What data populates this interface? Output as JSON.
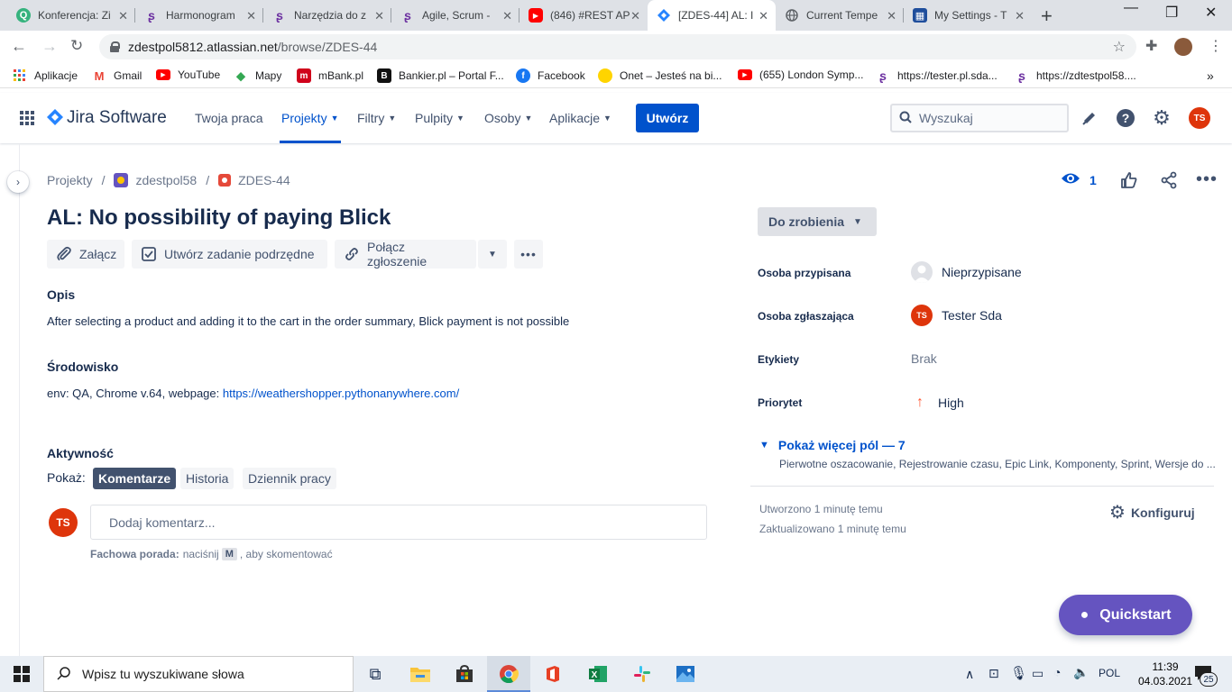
{
  "browser": {
    "tabs": [
      {
        "title": "Konferencja: Zi",
        "icon": "green-q-icon",
        "color": "#36b37e"
      },
      {
        "title": "Harmonogram",
        "icon": "purple-s-icon",
        "color": "#6b2fa0"
      },
      {
        "title": "Narzędzia do z",
        "icon": "purple-s-icon",
        "color": "#6b2fa0"
      },
      {
        "title": "Agile, Scrum -",
        "icon": "purple-s-icon",
        "color": "#6b2fa0"
      },
      {
        "title": "(846) #REST AP",
        "icon": "youtube-icon",
        "color": "#ff0000"
      },
      {
        "title": "[ZDES-44] AL: I",
        "icon": "jira-icon",
        "color": "#2684ff"
      },
      {
        "title": "Current Tempe",
        "icon": "globe-icon",
        "color": "#5f6368"
      },
      {
        "title": "My Settings - T",
        "icon": "settings-page-icon",
        "color": "#1f4e9c"
      }
    ],
    "url_host": "zdestpol5812.atlassian.net",
    "url_path": "/browse/ZDES-44",
    "bookmarks": [
      {
        "label": "Aplikacje",
        "icon": "apps-grid-icon"
      },
      {
        "label": "Gmail",
        "icon": "gmail-icon"
      },
      {
        "label": "YouTube",
        "icon": "youtube-icon"
      },
      {
        "label": "Mapy",
        "icon": "maps-icon"
      },
      {
        "label": "mBank.pl",
        "icon": "mbank-icon"
      },
      {
        "label": "Bankier.pl – Portal F...",
        "icon": "bankier-icon"
      },
      {
        "label": "Facebook",
        "icon": "facebook-icon"
      },
      {
        "label": "Onet – Jesteś na bi...",
        "icon": "onet-icon"
      },
      {
        "label": "(655) London Symp...",
        "icon": "youtube-icon"
      },
      {
        "label": "https://tester.pl.sda...",
        "icon": "purple-s-icon"
      },
      {
        "label": "https://zdtestpol58....",
        "icon": "purple-s-icon"
      }
    ]
  },
  "jira": {
    "logo_text": "Jira Software",
    "nav": [
      "Twoja praca",
      "Projekty",
      "Filtry",
      "Pulpity",
      "Osoby",
      "Aplikacje"
    ],
    "create_label": "Utwórz",
    "search_placeholder": "Wyszukaj",
    "user_initials": "TS"
  },
  "issue": {
    "breadcrumb": [
      "Projekty",
      "zdestpol58",
      "ZDES-44"
    ],
    "watchers": "1",
    "title": "AL: No possibility of paying Blick",
    "toolbar": {
      "attach": "Załącz",
      "subtask": "Utwórz zadanie podrzędne",
      "link": "Połącz zgłoszenie"
    },
    "description_heading": "Opis",
    "description": "After selecting a product and adding it to the cart in the order summary, Blick payment is not possible",
    "environment_heading": "Środowisko",
    "environment_prefix": "env: QA, Chrome v.64, webpage: ",
    "environment_link": "https://weathershopper.pythonanywhere.com/",
    "activity_heading": "Aktywność",
    "activity_show": "Pokaż:",
    "activity_tabs": [
      "Komentarze",
      "Historia",
      "Dziennik pracy"
    ],
    "comment_placeholder": "Dodaj komentarz...",
    "tip_bold": "Fachowa porada:",
    "tip_pre": "naciśnij",
    "tip_key": "M",
    "tip_post": ", aby skomentować",
    "status": "Do zrobienia",
    "fields": [
      {
        "label": "Osoba przypisana",
        "value": "Nieprzypisane"
      },
      {
        "label": "Osoba zgłaszająca",
        "value": "Tester Sda"
      },
      {
        "label": "Etykiety",
        "value": "Brak"
      },
      {
        "label": "Priorytet",
        "value": "High"
      }
    ],
    "more_fields": "Pokaż więcej pól — 7",
    "more_fields_sub": "Pierwotne oszacowanie, Rejestrowanie czasu, Epic Link, Komponenty, Sprint, Wersje do ...",
    "created": "Utworzono 1 minutę temu",
    "updated": "Zaktualizowano 1 minutę temu",
    "configure": "Konfiguruj",
    "quickstart": "Quickstart"
  },
  "taskbar": {
    "search_placeholder": "Wpisz tu wyszukiwane słowa",
    "language": "POL",
    "time": "11:39",
    "date": "04.03.2021",
    "notifications": "25"
  },
  "colors": {
    "jira_blue": "#0052cc",
    "avatar_red": "#de350b",
    "quickstart_purple": "#6554c0",
    "priority_high": "#ff5630"
  }
}
